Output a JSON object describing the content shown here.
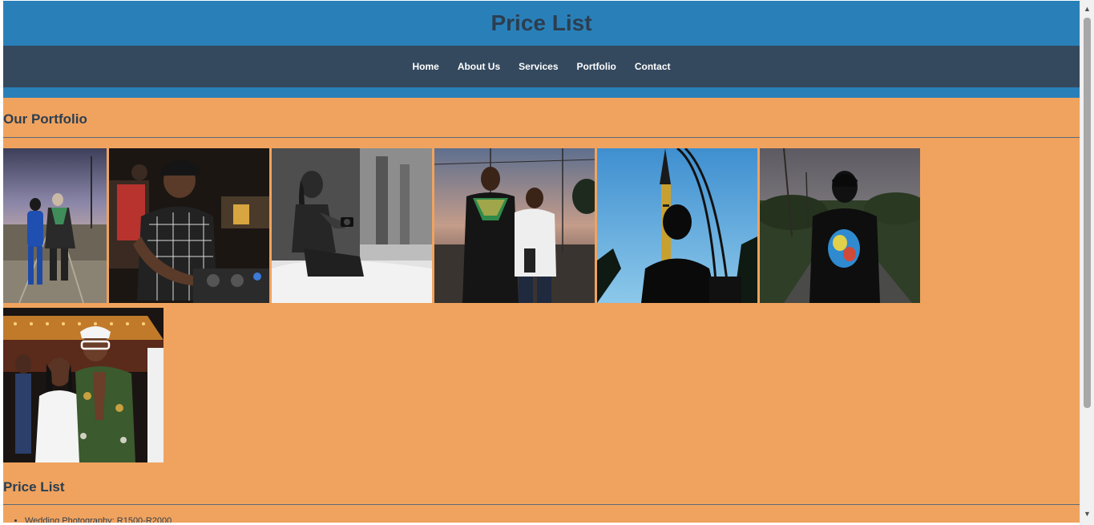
{
  "header": {
    "title": "Price List"
  },
  "nav": {
    "items": [
      {
        "label": "Home"
      },
      {
        "label": "About Us"
      },
      {
        "label": "Services"
      },
      {
        "label": "Portfolio"
      },
      {
        "label": "Contact"
      }
    ]
  },
  "portfolio": {
    "heading": "Our Portfolio",
    "photos": [
      {
        "subject": "couple-walking-on-railway-tracks"
      },
      {
        "subject": "dj-at-turntables"
      },
      {
        "subject": "woman-with-camera-black-and-white"
      },
      {
        "subject": "graduate-with-boy-on-tracks"
      },
      {
        "subject": "silhouette-with-church-tower"
      },
      {
        "subject": "man-in-cap-on-road"
      },
      {
        "subject": "party-couple-smiling"
      }
    ]
  },
  "prices": {
    "heading": "Price List",
    "items": [
      {
        "text": "Wedding Photography: R1500-R2000"
      }
    ]
  },
  "colors": {
    "header_blue": "#2980b9",
    "nav_dark": "#34495e",
    "page_orange": "#f0a35e",
    "heading_text": "#2c3e50"
  }
}
